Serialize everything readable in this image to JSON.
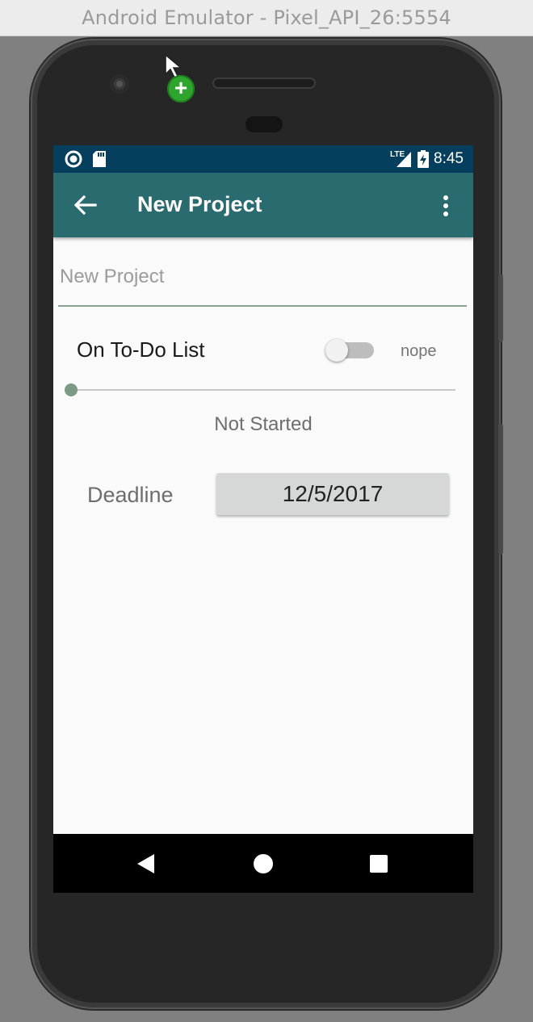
{
  "window": {
    "title": "Android Emulator - Pixel_API_26:5554"
  },
  "status_bar": {
    "left_icons": [
      "circle-notification-icon",
      "sd-card-icon"
    ],
    "network": "LTE",
    "time": "8:45"
  },
  "app_bar": {
    "title": "New Project",
    "back_icon": "back-arrow-icon",
    "menu_icon": "overflow-menu-icon"
  },
  "form": {
    "project_name": {
      "placeholder": "New Project",
      "value": ""
    },
    "todo": {
      "label": "On To-Do List",
      "checked": false,
      "state_text": "nope"
    },
    "progress": {
      "value_fraction": 0,
      "status_text": "Not Started"
    },
    "deadline": {
      "label": "Deadline",
      "value": "12/5/2017"
    }
  },
  "nav_bar": {
    "back_icon": "nav-back-triangle-icon",
    "home_icon": "nav-home-circle-icon",
    "recents_icon": "nav-recents-square-icon"
  },
  "colors": {
    "status_bar": "#063e5d",
    "app_bar": "#2a6b6f",
    "accent": "#7c9a86"
  }
}
